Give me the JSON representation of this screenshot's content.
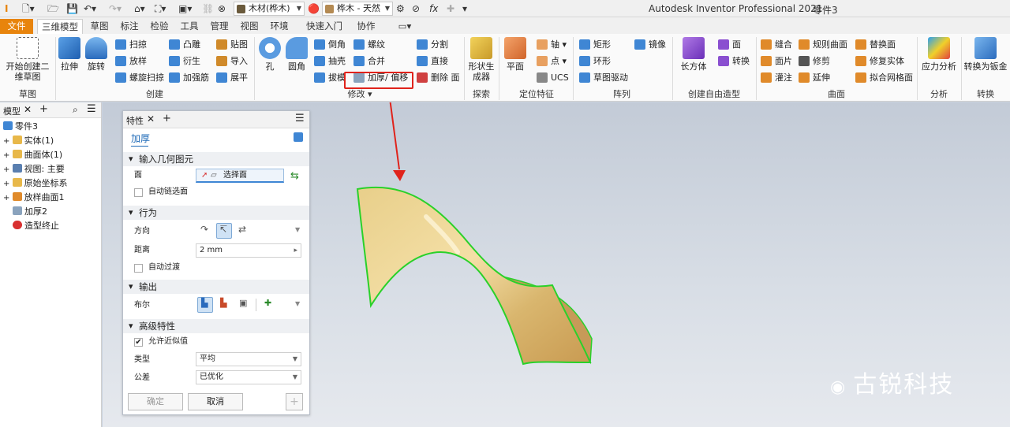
{
  "titlebar": {
    "material": "木材(桦木)",
    "appearance": "桦木 - 天然",
    "app_title": "Autodesk Inventor Professional 2021",
    "document": "零件3"
  },
  "tabs": [
    "文件",
    "三维模型",
    "草图",
    "标注",
    "检验",
    "工具",
    "管理",
    "视图",
    "环境",
    "快速入门",
    "协作"
  ],
  "ribbon": {
    "sketch": {
      "start_2d_sketch": "开始创建二维草图",
      "group": "草图"
    },
    "create": {
      "extrude": "拉伸",
      "revolve": "旋转",
      "sweep": "扫掠",
      "loft": "放样",
      "coil": "螺旋扫掠",
      "emboss": "凸雕",
      "derive": "衍生",
      "rib": "加强筋",
      "decal": "贴图",
      "import": "导入",
      "unwrap": "展平",
      "group": "创建"
    },
    "modify": {
      "hole": "孔",
      "fillet": "圆角",
      "chamfer": "倒角",
      "shell": "抽壳",
      "draft": "拔模",
      "thread": "螺纹",
      "combine": "合并",
      "thicken": "加厚/ 偏移",
      "split": "分割",
      "direct": "直接",
      "delete_face": "删除 面",
      "group": "修改"
    },
    "explore": {
      "shape_generator": "形状生成器",
      "group": "探索"
    },
    "work_features": {
      "plane": "平面",
      "axis": "轴",
      "point": "点",
      "ucs": "UCS",
      "group": "定位特征"
    },
    "pattern": {
      "rectangular": "矩形",
      "circular": "环形",
      "sketch_driven": "草图驱动",
      "mirror": "镜像",
      "group": "阵列"
    },
    "freeform": {
      "box": "长方体",
      "face": "面",
      "convert": "转换",
      "group": "创建自由造型"
    },
    "surface": {
      "stitch": "缝合",
      "patch": "面片",
      "sculpt": "灌注",
      "ruled": "规则曲面",
      "trim": "修剪",
      "extend": "延伸",
      "replace_face": "替换面",
      "repair": "修复实体",
      "fit_mesh": "拟合网格面",
      "group": "曲面"
    },
    "analysis": {
      "stress": "应力分析",
      "group": "分析"
    },
    "convert": {
      "to_sheet_metal": "转换为钣金",
      "group": "转换"
    }
  },
  "browser": {
    "tab": "模型",
    "items": [
      {
        "label": "零件3",
        "level": 0
      },
      {
        "label": "实体(1)",
        "level": 1
      },
      {
        "label": "曲面体(1)",
        "level": 1
      },
      {
        "label": "视图: 主要",
        "level": 1
      },
      {
        "label": "原始坐标系",
        "level": 1
      },
      {
        "label": "放样曲面1",
        "level": 1
      },
      {
        "label": "加厚2",
        "level": 1
      },
      {
        "label": "造型终止",
        "level": 1
      }
    ]
  },
  "properties": {
    "tab": "特性",
    "feature": "加厚",
    "input_geometry": {
      "header": "输入几何图元",
      "face_label": "面",
      "face_value": "选择面",
      "auto_chain": "自动链选面"
    },
    "behavior": {
      "header": "行为",
      "direction_label": "方向",
      "distance_label": "距离",
      "distance_value": "2 mm",
      "auto_blend": "自动过渡"
    },
    "output": {
      "header": "输出",
      "boolean_label": "布尔"
    },
    "advanced": {
      "header": "高级特性",
      "allow_approx": "允许近似值",
      "allow_approx_checked": true,
      "type_label": "类型",
      "type_value": "平均",
      "tolerance_label": "公差",
      "tolerance_value": "已优化"
    },
    "ok": "确定",
    "cancel": "取消"
  },
  "watermark": "古锐科技",
  "colors": {
    "accent": "#e8840c",
    "highlight": "#e0231b",
    "selection": "#2ad12a"
  }
}
